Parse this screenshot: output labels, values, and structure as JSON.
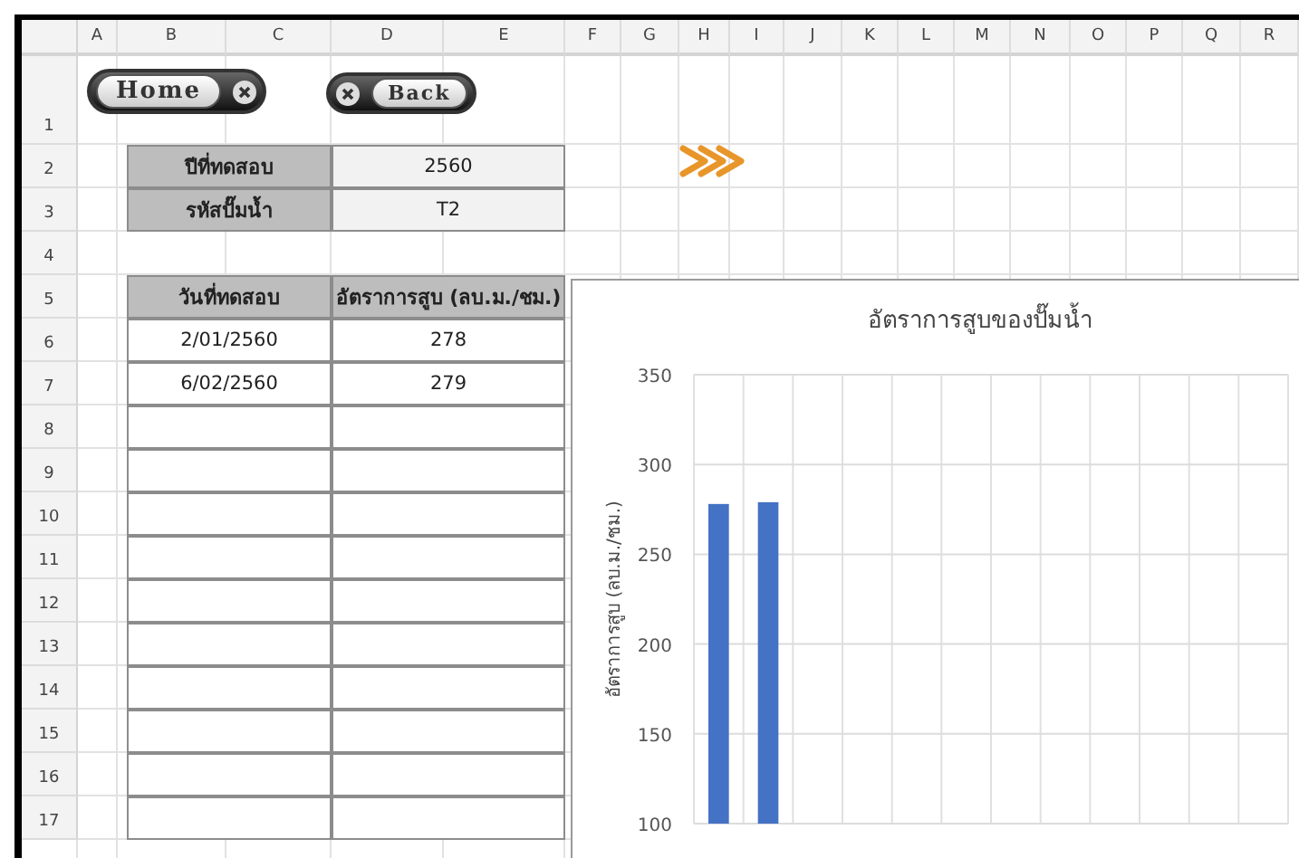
{
  "columns": [
    "A",
    "B",
    "C",
    "D",
    "E",
    "F",
    "G",
    "H",
    "I",
    "J",
    "K",
    "L",
    "M",
    "N",
    "O",
    "P",
    "Q",
    "R"
  ],
  "row_numbers": [
    "1",
    "2",
    "3",
    "4",
    "5",
    "6",
    "7",
    "8",
    "9",
    "10",
    "11",
    "12",
    "13",
    "14",
    "15",
    "16",
    "17"
  ],
  "buttons": [
    {
      "label": "Home",
      "kind": "home"
    },
    {
      "label": "Back",
      "kind": "back"
    }
  ],
  "info": [
    {
      "label": "ปีที่ทดสอบ",
      "value": "2560"
    },
    {
      "label": "รหัสปั๊มน้ำ",
      "value": "T2"
    }
  ],
  "table": {
    "columns": [
      "วันที่ทดสอบ",
      "อัตราการสูบ (ลบ.ม./ชม.)"
    ],
    "rows": [
      [
        "2/01/2560",
        "278"
      ],
      [
        "6/02/2560",
        "279"
      ]
    ]
  },
  "chart": {
    "chart_data": {
      "type": "bar",
      "grid": true,
      "title": "อัตราการสูบของปั๊มน้ำ",
      "ylabel": "อัตราการสูบ (ลบ.ม./ชม.)",
      "ylim": [
        100,
        350
      ],
      "yticks": [
        100,
        150,
        200,
        250,
        300,
        350
      ],
      "series": [
        {
          "color": "#4472c4",
          "values": [
            278,
            279,
            null,
            null,
            null,
            null,
            null,
            null,
            null,
            null,
            null,
            null
          ]
        }
      ]
    }
  }
}
